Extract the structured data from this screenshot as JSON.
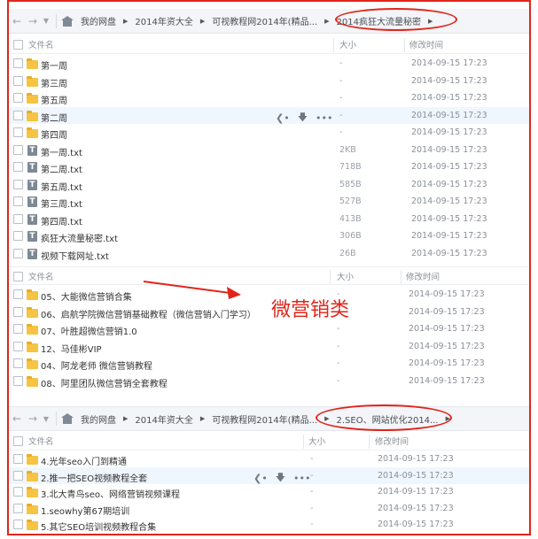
{
  "colors": {
    "accent_red": "#e1251b",
    "folder": "#f6c342",
    "header_bg": "#f3f5f8"
  },
  "top": {
    "breadcrumbs": [
      "我的网盘",
      "2014年资大全",
      "可视教程网2014年(精品...",
      "2014疯狂大流量秘密"
    ],
    "columns": {
      "name": "文件名",
      "size": "大小",
      "time": "修改时间"
    },
    "rows": [
      {
        "icon": "folder-icon",
        "name": "第一周",
        "size": "-",
        "time": "2014-09-15 17:23"
      },
      {
        "icon": "folder-icon",
        "name": "第三周",
        "size": "-",
        "time": "2014-09-15 17:23"
      },
      {
        "icon": "folder-icon",
        "name": "第五周",
        "size": "-",
        "time": "2014-09-15 17:23"
      },
      {
        "icon": "folder-icon",
        "name": "第二周",
        "size": "-",
        "time": "2014-09-15 17:23"
      },
      {
        "icon": "folder-icon",
        "name": "第四周",
        "size": "-",
        "time": "2014-09-15 17:23"
      },
      {
        "icon": "txt-icon",
        "name": "第一周.txt",
        "size": "2KB",
        "time": "2014-09-15 17:23"
      },
      {
        "icon": "txt-icon",
        "name": "第二周.txt",
        "size": "718B",
        "time": "2014-09-15 17:23"
      },
      {
        "icon": "txt-icon",
        "name": "第五周.txt",
        "size": "585B",
        "time": "2014-09-15 17:23"
      },
      {
        "icon": "txt-icon",
        "name": "第三周.txt",
        "size": "527B",
        "time": "2014-09-15 17:23"
      },
      {
        "icon": "txt-icon",
        "name": "第四周.txt",
        "size": "413B",
        "time": "2014-09-15 17:23"
      },
      {
        "icon": "txt-icon",
        "name": "疯狂大流量秘密.txt",
        "size": "306B",
        "time": "2014-09-15 17:23"
      },
      {
        "icon": "txt-icon",
        "name": "视频下载网址.txt",
        "size": "26B",
        "time": "2014-09-15 17:23"
      }
    ]
  },
  "middle": {
    "columns": {
      "name": "文件名",
      "size": "大小",
      "time": "修改时间"
    },
    "rows": [
      {
        "icon": "folder-icon",
        "name": "05、大能微信营销合集",
        "size": "-",
        "time": "2014-09-15 17:23"
      },
      {
        "icon": "folder-icon",
        "name": "06、启航学院微信营销基础教程（微信营销入门学习）",
        "size": "-",
        "time": "2014-09-15 17:23"
      },
      {
        "icon": "folder-icon",
        "name": "07、叶胜超微信营销1.0",
        "size": "-",
        "time": "2014-09-15 17:23"
      },
      {
        "icon": "folder-icon",
        "name": "12、马佳彬VIP",
        "size": "-",
        "time": "2014-09-15 17:23"
      },
      {
        "icon": "folder-icon",
        "name": "04、阿龙老师 微信营销教程",
        "size": "-",
        "time": "2014-09-15 17:23"
      },
      {
        "icon": "folder-icon",
        "name": "08、阿里团队微信营销全套教程",
        "size": "-",
        "time": "2014-09-15 17:23"
      }
    ],
    "annotation": "微营销类"
  },
  "bottom": {
    "breadcrumbs": [
      "我的网盘",
      "2014年资大全",
      "可视教程网2014年(精品...",
      "2.SEO、网站优化2014..."
    ],
    "columns": {
      "name": "文件名",
      "size": "大小",
      "time": "修改时间"
    },
    "rows": [
      {
        "icon": "folder-icon",
        "name": "4.光年seo入门到精通",
        "size": "-",
        "time": "2014-09-15 17:23"
      },
      {
        "icon": "folder-icon",
        "name": "2.推一把SEO视频教程全套",
        "size": "-",
        "time": "2014-09-15 17:23"
      },
      {
        "icon": "folder-icon",
        "name": "3.北大青鸟seo、网络营销视频课程",
        "size": "-",
        "time": "2014-09-15 17:23"
      },
      {
        "icon": "folder-icon",
        "name": "1.seowhy第67期培训",
        "size": "-",
        "time": "2014-09-15 17:23"
      },
      {
        "icon": "folder-icon",
        "name": "5.其它SEO培训视频教程合集",
        "size": "-",
        "time": "2014-09-15 17:23"
      }
    ]
  }
}
